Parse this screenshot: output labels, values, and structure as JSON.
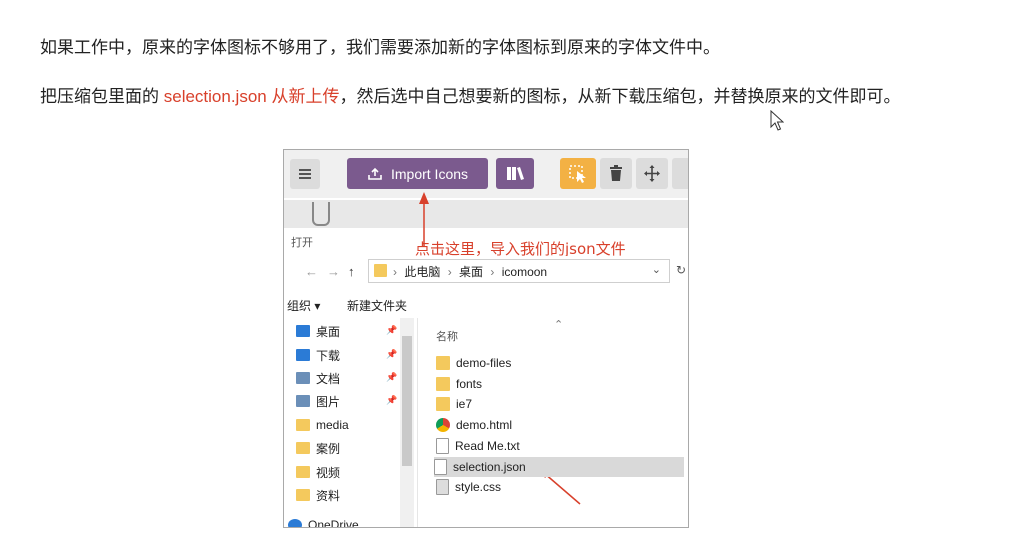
{
  "paragraphs": {
    "p1": "如果工作中，原来的字体图标不够用了，我们需要添加新的字体图标到原来的字体文件中。",
    "p2_before": "把压缩包里面的 ",
    "p2_red": "selection.json 从新上传",
    "p2_after": "，然后选中自己想要新的图标，从新下载压缩包，并替换原来的文件即可。"
  },
  "toolbar": {
    "import_label": "Import Icons"
  },
  "annotation": "点击这里，导入我们的json文件",
  "dialog": {
    "title": "打开",
    "breadcrumbs": [
      "此电脑",
      "桌面",
      "icomoon"
    ],
    "organize_label": "组织 ▾",
    "new_folder_label": "新建文件夹",
    "column_name": "名称"
  },
  "nav_items": [
    {
      "label": "桌面",
      "color": "#2b7bd6"
    },
    {
      "label": "下载",
      "color": "#2b7bd6"
    },
    {
      "label": "文档",
      "color": "#6b8fb8"
    },
    {
      "label": "图片",
      "color": "#6b8fb8"
    },
    {
      "label": "media",
      "color": "#f4c95d"
    },
    {
      "label": "案例",
      "color": "#f4c95d"
    },
    {
      "label": "视频",
      "color": "#f4c95d"
    },
    {
      "label": "资料",
      "color": "#f4c95d"
    },
    {
      "label": "OneDrive",
      "color": "#2b7bd6"
    }
  ],
  "files": [
    {
      "name": "demo-files",
      "type": "folder"
    },
    {
      "name": "fonts",
      "type": "folder"
    },
    {
      "name": "ie7",
      "type": "folder"
    },
    {
      "name": "demo.html",
      "type": "chrome"
    },
    {
      "name": "Read Me.txt",
      "type": "doc"
    },
    {
      "name": "selection.json",
      "type": "doc",
      "selected": true
    },
    {
      "name": "style.css",
      "type": "css"
    }
  ],
  "colors": {
    "accent_red": "#d8402b",
    "purple": "#7b5a8e",
    "orange": "#f3b144"
  }
}
